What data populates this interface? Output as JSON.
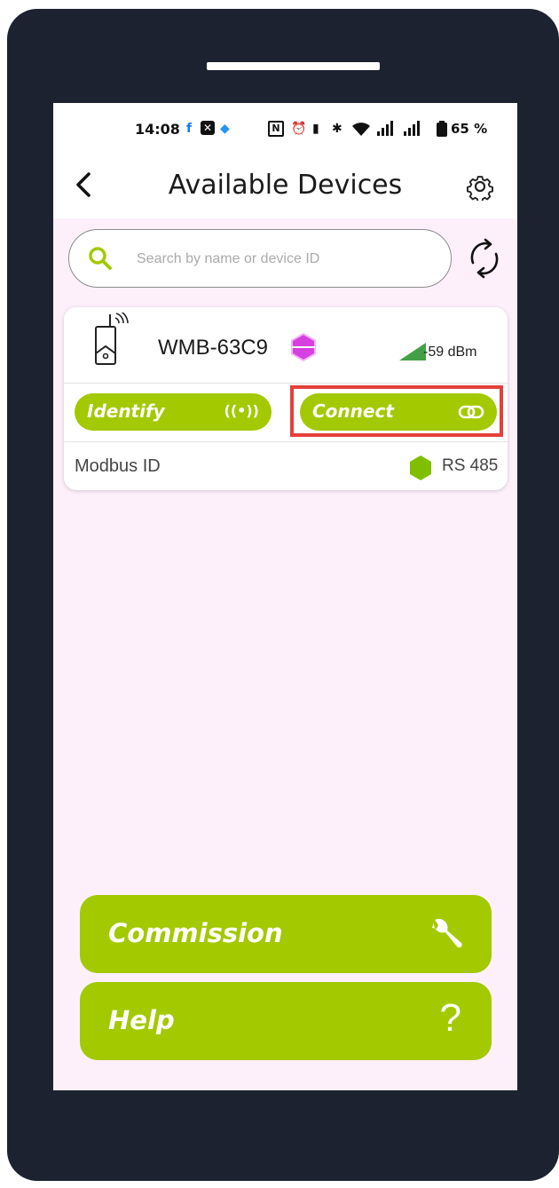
{
  "status_bar": {
    "time": "14:08",
    "battery": "65 %",
    "icons": [
      "facebook-icon",
      "x-icon",
      "app-icon",
      "nfc-icon",
      "alarm-icon",
      "vibrate-icon",
      "bluetooth-icon",
      "wifi-icon",
      "signal-icon",
      "signal-icon",
      "battery-icon"
    ]
  },
  "header": {
    "title": "Available Devices",
    "back_icon": "chevron-left-icon",
    "settings_icon": "gear-icon"
  },
  "search": {
    "placeholder": "Search by name or device ID",
    "value": "",
    "refresh_icon": "refresh-icon"
  },
  "device": {
    "name": "WMB-63C9",
    "signal": "-59 dBm",
    "identify_label": "Identify",
    "identify_icon": "((•))",
    "connect_label": "Connect",
    "modbus_label": "Modbus ID",
    "protocol": "RS 485",
    "colors": {
      "accent": "#a3c900",
      "purple_badge": "#d63fe0",
      "green_badge": "#7fbf00",
      "signal": "#43a047",
      "highlight": "#e5403a"
    }
  },
  "actions": {
    "commission_label": "Commission",
    "help_label": "Help",
    "help_icon_glyph": "?"
  }
}
